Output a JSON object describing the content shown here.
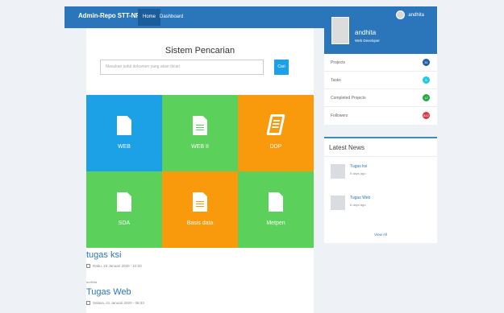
{
  "navbar": {
    "brand": "Admin-Repo STT-NF",
    "home_label": "Home",
    "dashboard_label": "Dashboard",
    "user_name": "andhita"
  },
  "search": {
    "title": "Sistem Pencarian",
    "placeholder": "Masukan judul dokumen yang akan dicari",
    "button_label": "Cari"
  },
  "categories": [
    {
      "label": "WEB",
      "color": "#1da1e6",
      "icon": "document-icon"
    },
    {
      "label": "WEB II",
      "color": "#5bd05b",
      "icon": "document-text-icon"
    },
    {
      "label": "DDP",
      "color": "#f99a0d",
      "icon": "book-icon"
    },
    {
      "label": "SDA",
      "color": "#5bd05b",
      "icon": "document-icon"
    },
    {
      "label": "Basis data",
      "color": "#f99a0d",
      "icon": "document-text-icon"
    },
    {
      "label": "Metpen",
      "color": "#5bd05b",
      "icon": "document-icon"
    }
  ],
  "posts": [
    {
      "title": "tugas ksi",
      "date": "Rabu, 22 Januari 2020 - 10:20"
    },
    {
      "title": "Tugas Web",
      "date": "Selasa, 21 Januari 2020 - 08:33"
    }
  ],
  "post_label": "andhita",
  "profile": {
    "name": "andhita",
    "role": "Web Developer"
  },
  "stats": [
    {
      "label": "Projects",
      "value": "31",
      "color": "#1f5fa8"
    },
    {
      "label": "Tasks",
      "value": "5",
      "color": "#1ecbe1"
    },
    {
      "label": "Completed Projects",
      "value": "12",
      "color": "#28a745"
    },
    {
      "label": "Followers",
      "value": "842",
      "color": "#dc3545"
    }
  ],
  "latest_news": {
    "title": "Latest News",
    "items": [
      {
        "title": "Tugas ksi",
        "time": "5 days ago"
      },
      {
        "title": "Tugas Web",
        "time": "6 days ago"
      }
    ],
    "view_all": "View All"
  }
}
